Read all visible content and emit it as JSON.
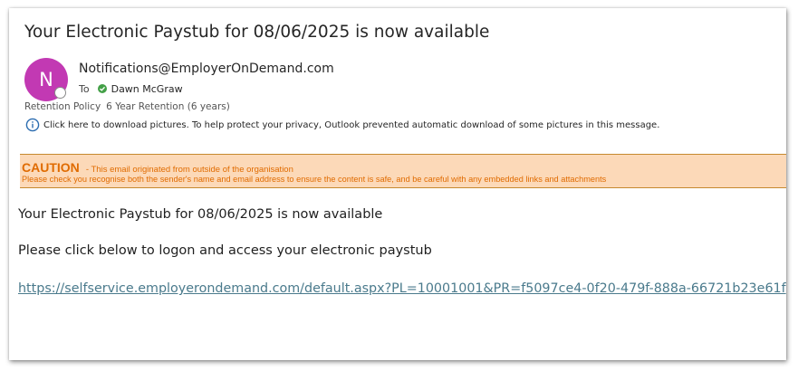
{
  "email": {
    "subject": "Your Electronic Paystub for 08/06/2025 is now available",
    "sender": {
      "initial": "N",
      "address": "Notifications@EmployerOnDemand.com",
      "avatar_color": "#c239b3"
    },
    "to_label": "To",
    "recipient": "Dawn McGraw",
    "retention_label": "Retention Policy",
    "retention_value": "6 Year Retention (6 years)",
    "info_message": "Click here to download pictures. To help protect your privacy, Outlook prevented automatic download of some pictures in this message.",
    "info_icon": "info-circle-icon"
  },
  "banner": {
    "title": "CAUTION",
    "subtitle": "- This email originated from outside of the organisation",
    "detail": "Please check you recognise both the sender's name and email address to ensure the content is safe, and be careful with any embedded links and attachments",
    "background_color": "#fcd9b8",
    "text_color": "#e06b00"
  },
  "body": {
    "line1": "Your Electronic Paystub for 08/06/2025 is now available",
    "line2": "Please click below to logon and access your electronic paystub",
    "link": "https://selfservice.employerondemand.com/default.aspx?PL=10001001&PR=f5097ce4-0f20-479f-888a-66721b23e61f",
    "link_color": "#4a7a8c"
  }
}
